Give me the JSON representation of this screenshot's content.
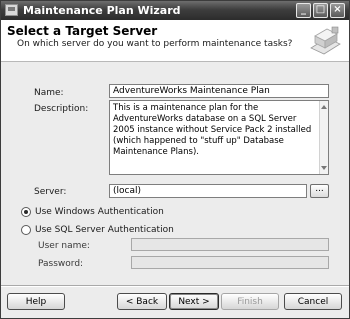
{
  "window": {
    "title": "Maintenance Plan Wizard"
  },
  "title_buttons": {
    "minimize": "_",
    "maximize": "□",
    "close": "×"
  },
  "header": {
    "title": "Select a Target Server",
    "subtitle": "On which server do you want to perform maintenance tasks?",
    "graphic_icon": "wizard-graphic-icon"
  },
  "form": {
    "name_label": "Name:",
    "name_value": "AdventureWorks Maintenance Plan",
    "description_label": "Description:",
    "description_value": "This is a maintenance plan for the AdventureWorks database on a SQL Server 2005 instance without Service Pack 2 installed (which happened to \"stuff up\" Database Maintenance Plans).",
    "server_label": "Server:",
    "server_value": "(local)",
    "browse_label": "...",
    "windows_auth_label": "Use Windows Authentication",
    "windows_auth_selected": true,
    "sql_auth_label": "Use SQL Server Authentication",
    "sql_auth_selected": false,
    "username_label": "User name:",
    "username_value": "",
    "password_label": "Password:",
    "password_value": ""
  },
  "footer": {
    "help": "Help",
    "back": "< Back",
    "next": "Next >",
    "finish": "Finish",
    "cancel": "Cancel"
  }
}
